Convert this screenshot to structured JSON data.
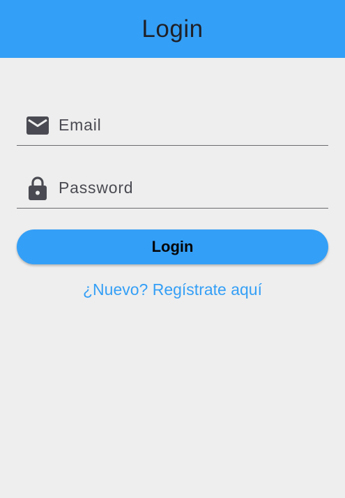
{
  "app_bar": {
    "title": "Login"
  },
  "form": {
    "email": {
      "icon": "email-icon",
      "placeholder": "Email",
      "value": ""
    },
    "password": {
      "icon": "lock-icon",
      "placeholder": "Password",
      "value": ""
    },
    "login_button_label": "Login",
    "register_link_text": "¿Nuevo? Regístrate aquí"
  },
  "colors": {
    "primary": "#349ff6",
    "background": "#eeeeee",
    "icon": "#4a4b52",
    "text": "#1f2027"
  }
}
